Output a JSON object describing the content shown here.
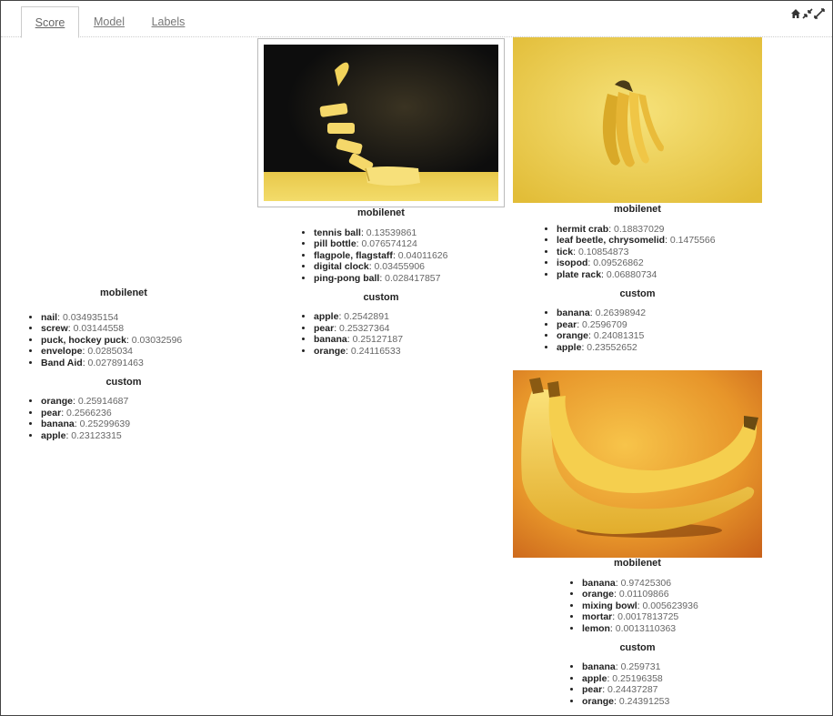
{
  "tabs": [
    {
      "label": "Score"
    },
    {
      "label": "Model"
    },
    {
      "label": "Labels"
    }
  ],
  "results": [
    {
      "mobilenet_title": "mobilenet",
      "mobilenet": [
        {
          "label": "nail",
          "score": "0.034935154"
        },
        {
          "label": "screw",
          "score": "0.03144558"
        },
        {
          "label": "puck, hockey puck",
          "score": "0.03032596"
        },
        {
          "label": "envelope",
          "score": "0.0285034"
        },
        {
          "label": "Band Aid",
          "score": "0.027891463"
        }
      ],
      "custom_title": "custom",
      "custom": [
        {
          "label": "orange",
          "score": "0.25914687"
        },
        {
          "label": "pear",
          "score": "0.2566236"
        },
        {
          "label": "banana",
          "score": "0.25299639"
        },
        {
          "label": "apple",
          "score": "0.23123315"
        }
      ]
    },
    {
      "mobilenet_title": "mobilenet",
      "mobilenet": [
        {
          "label": "tennis ball",
          "score": "0.13539861"
        },
        {
          "label": "pill bottle",
          "score": "0.076574124"
        },
        {
          "label": "flagpole, flagstaff",
          "score": "0.04011626"
        },
        {
          "label": "digital clock",
          "score": "0.03455906"
        },
        {
          "label": "ping-pong ball",
          "score": "0.028417857"
        }
      ],
      "custom_title": "custom",
      "custom": [
        {
          "label": "apple",
          "score": "0.2542891"
        },
        {
          "label": "pear",
          "score": "0.25327364"
        },
        {
          "label": "banana",
          "score": "0.25127187"
        },
        {
          "label": "orange",
          "score": "0.24116533"
        }
      ]
    },
    {
      "mobilenet_title": "mobilenet",
      "mobilenet": [
        {
          "label": "hermit crab",
          "score": "0.18837029"
        },
        {
          "label": "leaf beetle, chrysomelid",
          "score": "0.1475566"
        },
        {
          "label": "tick",
          "score": "0.10854873"
        },
        {
          "label": "isopod",
          "score": "0.09526862"
        },
        {
          "label": "plate rack",
          "score": "0.06880734"
        }
      ],
      "custom_title": "custom",
      "custom": [
        {
          "label": "banana",
          "score": "0.26398942"
        },
        {
          "label": "pear",
          "score": "0.2596709"
        },
        {
          "label": "orange",
          "score": "0.24081315"
        },
        {
          "label": "apple",
          "score": "0.23552652"
        }
      ]
    },
    {
      "mobilenet_title": "mobilenet",
      "mobilenet": [
        {
          "label": "banana",
          "score": "0.97425306"
        },
        {
          "label": "orange",
          "score": "0.01109866"
        },
        {
          "label": "mixing bowl",
          "score": "0.005623936"
        },
        {
          "label": "mortar",
          "score": "0.0017813725"
        },
        {
          "label": "lemon",
          "score": "0.0013110363"
        }
      ],
      "custom_title": "custom",
      "custom": [
        {
          "label": "banana",
          "score": "0.259731"
        },
        {
          "label": "apple",
          "score": "0.25196358"
        },
        {
          "label": "pear",
          "score": "0.24437287"
        },
        {
          "label": "orange",
          "score": "0.24391253"
        }
      ]
    }
  ],
  "icons": [
    "home-icon",
    "collapse-icon",
    "expand-icon"
  ]
}
